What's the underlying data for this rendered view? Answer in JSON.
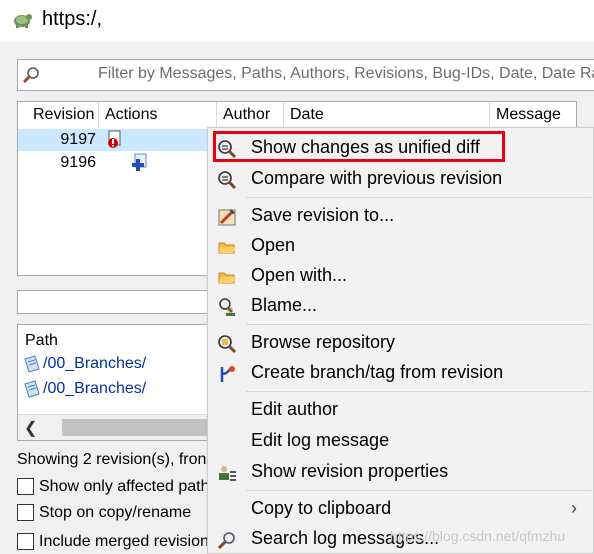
{
  "window": {
    "title": "https:/,"
  },
  "filter": {
    "placeholder": "Filter by Messages, Paths, Authors, Revisions, Bug-IDs, Date, Date Ran"
  },
  "log": {
    "columns": [
      "Revision",
      "Actions",
      "Author",
      "Date",
      "Message"
    ],
    "rows": [
      {
        "revision": "9197",
        "selected": true
      },
      {
        "revision": "9196",
        "selected": false
      }
    ]
  },
  "paths": {
    "header": "Path",
    "items": [
      "/00_Branches/",
      "/00_Branches/"
    ]
  },
  "status": {
    "text": "Showing 2 revision(s), fron"
  },
  "options": [
    "Show only affected path",
    "Stop on copy/rename",
    "Include merged revision"
  ],
  "menu": {
    "items": [
      {
        "label": "Show changes as unified diff",
        "icon": "diff-magnifier-icon"
      },
      {
        "label": "Compare with previous revision",
        "icon": "compare-magnifier-icon"
      },
      {
        "label": "Save revision to...",
        "icon": "save-revision-icon"
      },
      {
        "label": "Open",
        "icon": "folder-open-icon"
      },
      {
        "label": "Open with...",
        "icon": "folder-open-with-icon"
      },
      {
        "label": "Blame...",
        "icon": "blame-icon"
      },
      {
        "label": "Browse repository",
        "icon": "repo-browser-icon"
      },
      {
        "label": "Create branch/tag from revision",
        "icon": "branch-icon"
      },
      {
        "label": "Edit author",
        "icon": ""
      },
      {
        "label": "Edit log message",
        "icon": ""
      },
      {
        "label": "Show revision properties",
        "icon": "properties-icon"
      },
      {
        "label": "Copy to clipboard",
        "icon": ""
      },
      {
        "label": "Search log messages...",
        "icon": "search-log-icon"
      }
    ],
    "highlight_color": "#e60012"
  },
  "watermark": "https://blog.csdn.net/qfmzhu"
}
